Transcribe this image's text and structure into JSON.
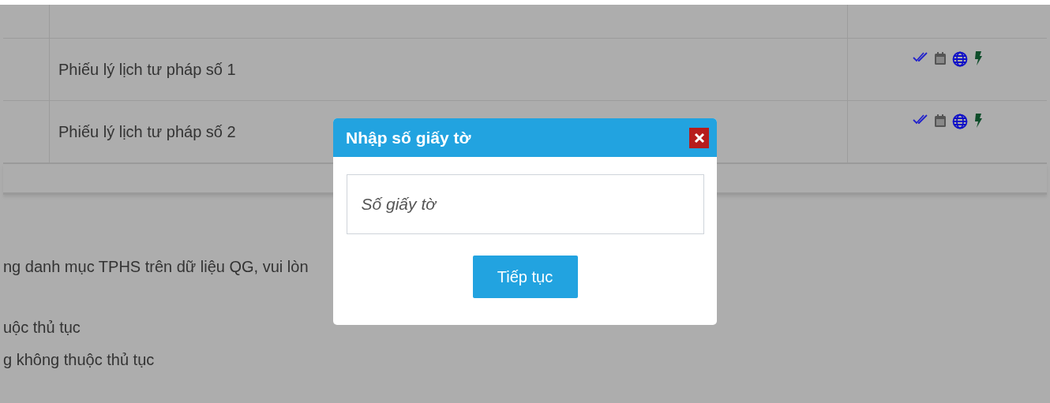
{
  "table": {
    "rows": [
      {
        "name": "Phiếu lý lịch tư pháp số 1"
      },
      {
        "name": "Phiếu lý lịch tư pháp số 2"
      }
    ]
  },
  "notes": [
    "ng danh mục TPHS trên dữ liệu QG, vui lòn",
    "uộc thủ tục",
    "g không thuộc thủ tục"
  ],
  "dialog": {
    "title": "Nhập số giấy tờ",
    "field": {
      "placeholder": "Số giấy tờ"
    },
    "button": "Tiếp tục"
  }
}
